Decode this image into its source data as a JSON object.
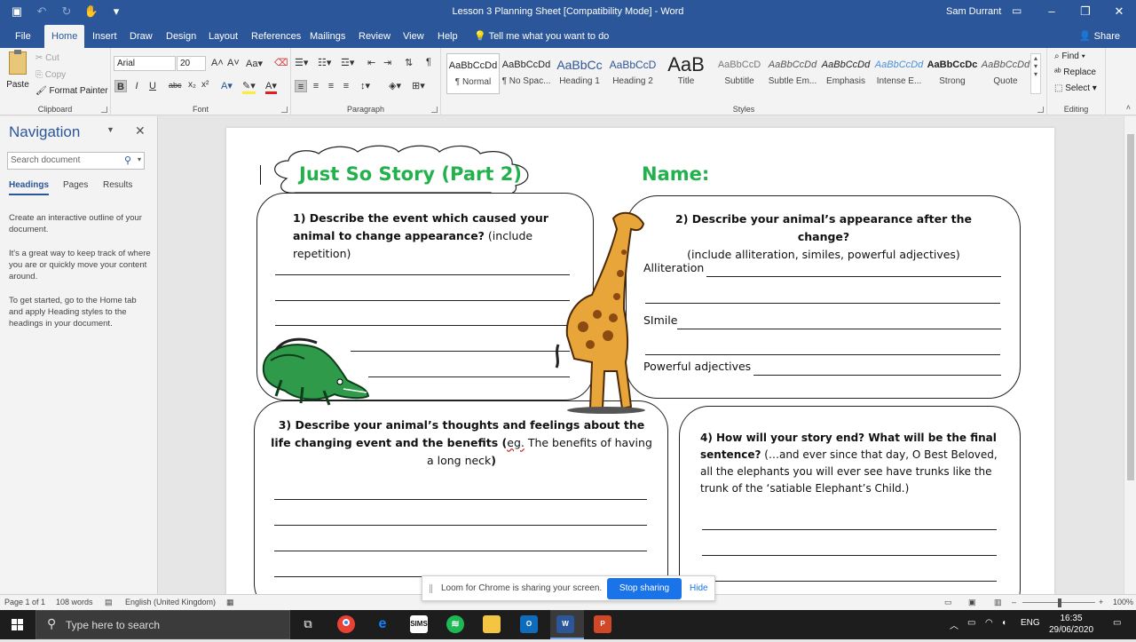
{
  "titlebar": {
    "doc_title": "Lesson 3 Planning Sheet [Compatibility Mode]  -  Word",
    "user": "Sam Durrant"
  },
  "tabs": [
    "File",
    "Home",
    "Insert",
    "Draw",
    "Design",
    "Layout",
    "References",
    "Mailings",
    "Review",
    "View",
    "Help"
  ],
  "tell_me": "Tell me what you want to do",
  "share": "Share",
  "clipboard": {
    "paste": "Paste",
    "cut": "Cut",
    "copy": "Copy",
    "format_painter": "Format Painter",
    "group": "Clipboard"
  },
  "font": {
    "name": "Arial",
    "size": "20",
    "group": "Font"
  },
  "paragraph": {
    "group": "Paragraph"
  },
  "styles": {
    "group": "Styles",
    "items": [
      {
        "preview": "AaBbCcDd",
        "name": "¶ Normal"
      },
      {
        "preview": "AaBbCcDd",
        "name": "¶ No Spac..."
      },
      {
        "preview": "AaBbCc",
        "name": "Heading 1"
      },
      {
        "preview": "AaBbCcD",
        "name": "Heading 2"
      },
      {
        "preview": "AaB",
        "name": "Title"
      },
      {
        "preview": "AaBbCcD",
        "name": "Subtitle"
      },
      {
        "preview": "AaBbCcDd",
        "name": "Subtle Em..."
      },
      {
        "preview": "AaBbCcDd",
        "name": "Emphasis"
      },
      {
        "preview": "AaBbCcDd",
        "name": "Intense E..."
      },
      {
        "preview": "AaBbCcDc",
        "name": "Strong"
      },
      {
        "preview": "AaBbCcDd",
        "name": "Quote"
      }
    ]
  },
  "editing": {
    "find": "Find",
    "replace": "Replace",
    "select": "Select",
    "group": "Editing"
  },
  "nav": {
    "title": "Navigation",
    "search_placeholder": "Search document",
    "tabs": [
      "Headings",
      "Pages",
      "Results"
    ],
    "p1": "Create an interactive outline of your document.",
    "p2": "It's a great way to keep track of where you are or quickly move your content around.",
    "p3": "To get started, go to the Home tab and apply Heading styles to the headings in your document."
  },
  "doc": {
    "title": "Just So Story (Part 2)",
    "name_label": "Name:",
    "q1_bold": "1)  Describe the event which caused your animal to change appearance?",
    "q1_note": "(include repetition)",
    "q2_bold": "2) Describe your animal’s appearance after the change?",
    "q2_note": "(include alliteration, similes, powerful adjectives)",
    "q2_alliteration": "Alliteration",
    "q2_simile": "SImile",
    "q2_adjectives": "Powerful adjectives",
    "q3_bold": "3) Describe your animal’s thoughts and feelings about the life changing event and the benefits (",
    "q3_eg": "eg.",
    "q3_note": " The benefits of having a long neck",
    "q3_close": ")",
    "q4_bold": "4) How will your story end? What will be the final sentence?",
    "q4_note": " (…and ever since that day, O Best Beloved, all the elephants you will ever see have trunks like the trunk of the ‘satiable Elephant’s Child.)"
  },
  "status": {
    "page": "Page 1 of 1",
    "words": "108 words",
    "language": "English (United Kingdom)",
    "zoom": "100%"
  },
  "loom": {
    "message": "Loom for Chrome is sharing your screen.",
    "stop": "Stop sharing",
    "hide": "Hide"
  },
  "taskbar": {
    "search": "Type here to search",
    "lang": "ENG",
    "time": "16:35",
    "date": "29/06/2020"
  },
  "colors": {
    "word_blue": "#2b579a",
    "title_green": "#22b14c",
    "loom_blue": "#1a73e8"
  }
}
